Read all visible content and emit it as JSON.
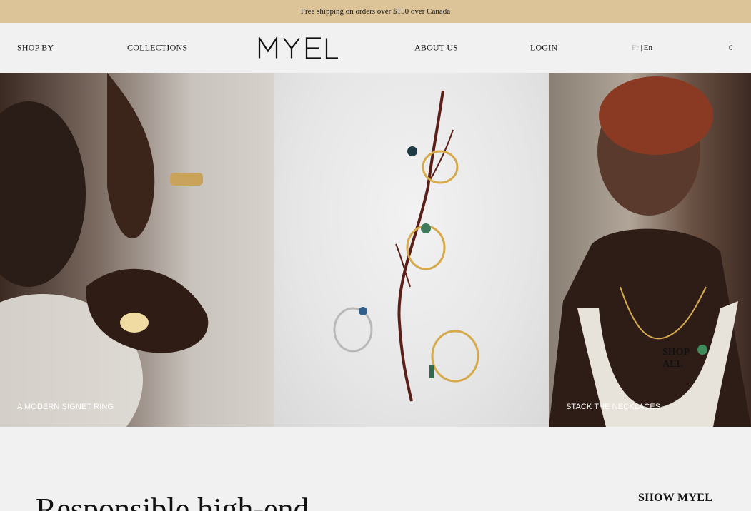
{
  "announcement": {
    "text": "Free shipping on orders over $150 over Canada"
  },
  "nav": {
    "shop_by": "SHOP BY",
    "collections": "COLLECTIONS",
    "logo_text": "MYEL",
    "about": "ABOUT US",
    "login": "LOGIN",
    "lang_fr": "Fr",
    "lang_sep": "|",
    "lang_en": "En",
    "cart_count": "0"
  },
  "hero": {
    "panels": [
      {
        "caption": "A MODERN SIGNET RING"
      },
      {
        "caption": ""
      },
      {
        "caption": "STACK THE NECKLACES"
      }
    ],
    "shop_all": "SHOP ALL"
  },
  "section": {
    "headline": "Responsible high-end",
    "show_myel": "SHOW MYEL"
  },
  "colors": {
    "announcement_bg": "#dcc398",
    "page_bg": "#f1f1f1",
    "text": "#111111",
    "muted_lang": "#b8b8b8"
  }
}
